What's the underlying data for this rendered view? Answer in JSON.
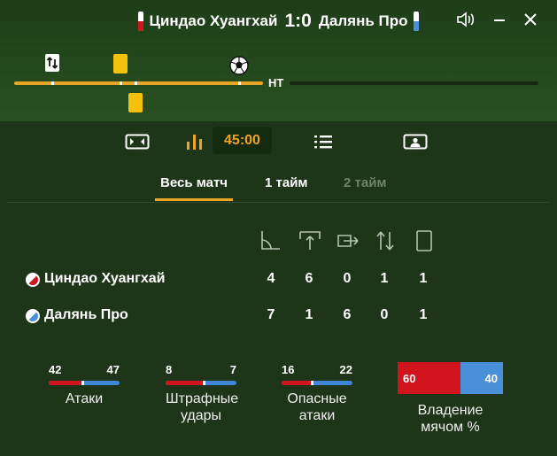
{
  "match": {
    "home_team": "Циндао Хуангхай",
    "away_team": "Далянь Про",
    "score": "1:0"
  },
  "timeline": {
    "half_label": "HT"
  },
  "toolbar": {
    "clock": "45:00"
  },
  "period_tabs": [
    "Весь матч",
    "1 тайм",
    "2 тайм"
  ],
  "stats_table": {
    "columns": [
      "corner-icon",
      "goal-kick-icon",
      "offside-icon",
      "substitution-icon",
      "card-icon"
    ],
    "rows": [
      {
        "team": "Циндао Хуангхай",
        "values": [
          "4",
          "6",
          "0",
          "1",
          "1"
        ]
      },
      {
        "team": "Далянь Про",
        "values": [
          "7",
          "1",
          "6",
          "0",
          "1"
        ]
      }
    ]
  },
  "bars": [
    {
      "label": "Атаки",
      "home": "42",
      "away": "47",
      "home_share": 0.472
    },
    {
      "label": "Штрафные удары",
      "home": "8",
      "away": "7",
      "home_share": 0.533
    },
    {
      "label": "Опасные атаки",
      "home": "16",
      "away": "22",
      "home_share": 0.421
    }
  ],
  "possession": {
    "label": "Владение мячом %",
    "home": "60",
    "away": "40",
    "home_share": 0.6
  },
  "colors": {
    "accent": "#f0a424",
    "home": "#d0151f",
    "away": "#4a90d9",
    "card": "#f4c20d"
  }
}
